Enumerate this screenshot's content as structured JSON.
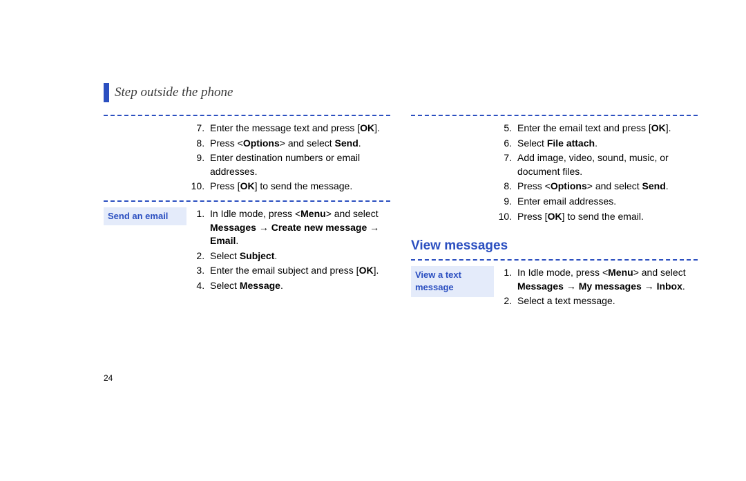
{
  "header": {
    "title": "Step outside the phone"
  },
  "left": {
    "first_steps": {
      "start": 7,
      "items": [
        {
          "pre": "Enter the message text and press [",
          "bold1": "OK",
          "post1": "]."
        },
        {
          "pre": "Press <",
          "bold1": "Options",
          "mid1": "> and select ",
          "bold2": "Send",
          "post2": "."
        },
        {
          "pre": "Enter destination numbers or email addresses."
        },
        {
          "pre": "Press [",
          "bold1": "OK",
          "post1": "] to send the message."
        }
      ]
    },
    "second_block": {
      "label": "Send an email",
      "start": 1,
      "items": [
        {
          "pre": "In Idle mode, press <",
          "bold1": "Menu",
          "mid1": "> and select ",
          "bold2": "Messages",
          "mid2": " → ",
          "bold3": "Create new message",
          "mid3": " → ",
          "bold4": "Email",
          "post4": "."
        },
        {
          "pre": "Select ",
          "bold1": "Subject",
          "post1": "."
        },
        {
          "pre": "Enter the email subject and press [",
          "bold1": "OK",
          "post1": "]."
        },
        {
          "pre": "Select ",
          "bold1": "Message",
          "post1": "."
        }
      ]
    }
  },
  "right": {
    "first_steps": {
      "start": 5,
      "items": [
        {
          "pre": "Enter the email text and press [",
          "bold1": "OK",
          "post1": "]."
        },
        {
          "pre": "Select ",
          "bold1": "File attach",
          "post1": "."
        },
        {
          "pre": "Add image, video, sound, music, or document files."
        },
        {
          "pre": "Press <",
          "bold1": "Options",
          "mid1": "> and select ",
          "bold2": "Send",
          "post2": "."
        },
        {
          "pre": "Enter email addresses."
        },
        {
          "pre": "Press [",
          "bold1": "OK",
          "post1": "] to send the email."
        }
      ]
    },
    "heading": "View messages",
    "second_block": {
      "label": "View a text message",
      "start": 1,
      "items": [
        {
          "pre": "In Idle mode, press <",
          "bold1": "Menu",
          "mid1": "> and select ",
          "bold2": "Messages",
          "mid2": " → ",
          "bold3": "My messages",
          "mid3": " → ",
          "bold4": "Inbox",
          "post4": "."
        },
        {
          "pre": "Select a text message."
        }
      ]
    }
  },
  "page_number": "24"
}
